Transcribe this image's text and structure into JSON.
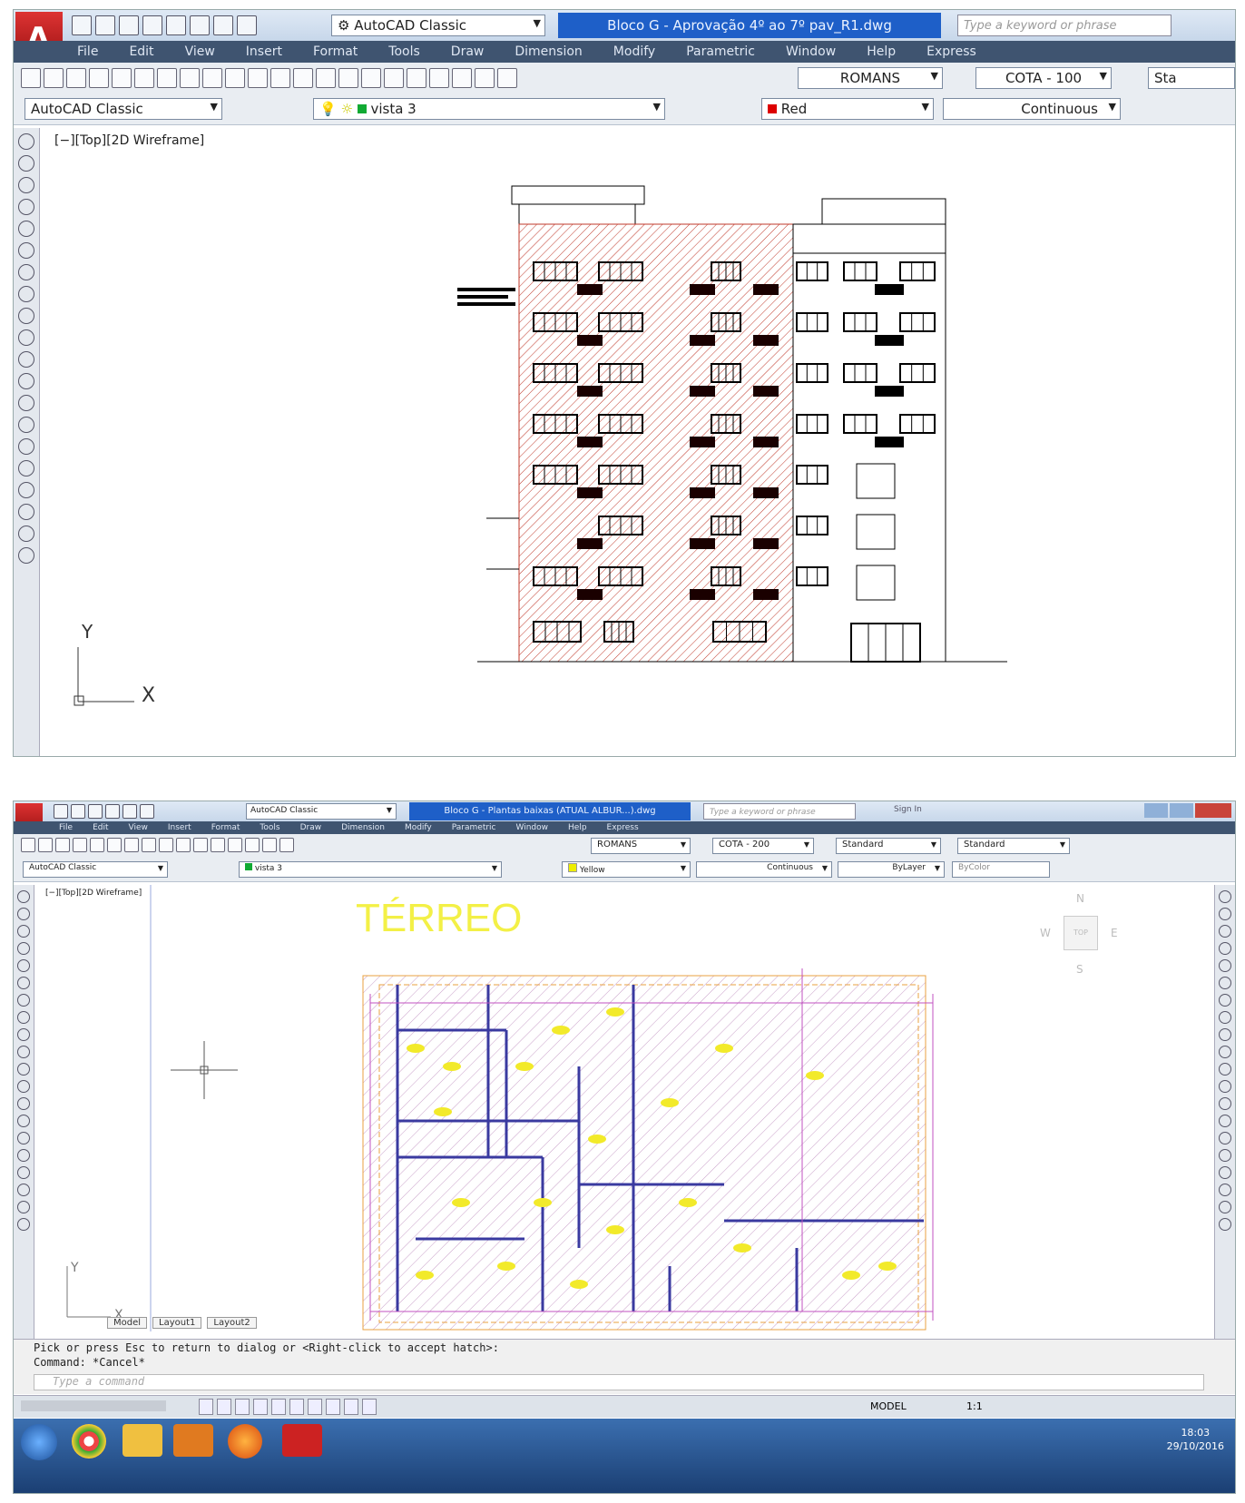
{
  "shot1": {
    "logo": "A",
    "workspace": "AutoCAD Classic",
    "doc_title": "Bloco G - Aprovação 4º ao 7º pav_R1.dwg",
    "search_placeholder": "Type a keyword or phrase",
    "menu": [
      "File",
      "Edit",
      "View",
      "Insert",
      "Format",
      "Tools",
      "Draw",
      "Dimension",
      "Modify",
      "Parametric",
      "Window",
      "Help",
      "Express"
    ],
    "text_style": "ROMANS",
    "dim_style": "COTA - 100",
    "table_style_partial": "Sta",
    "workspace_combo": "AutoCAD Classic",
    "layer": "vista 3",
    "color": "Red",
    "linetype": "Continuous",
    "viewport_label": "[−][Top][2D Wireframe]",
    "ucs_x": "X",
    "ucs_y": "Y"
  },
  "shot2": {
    "doc_title": "Bloco G - Plantas baixas (ATUAL ALBUR...).dwg",
    "search_placeholder": "Type a keyword or phrase",
    "sign_in": "Sign In",
    "workspace": "AutoCAD Classic",
    "menu": [
      "File",
      "Edit",
      "View",
      "Insert",
      "Format",
      "Tools",
      "Draw",
      "Dimension",
      "Modify",
      "Parametric",
      "Window",
      "Help",
      "Express"
    ],
    "text_style": "ROMANS",
    "dim_style": "COTA - 200",
    "table_style": "Standard",
    "mleader_style": "Standard",
    "workspace_combo": "AutoCAD Classic",
    "layer": "vista 3",
    "color": "Yellow",
    "linetype": "Continuous",
    "lineweight": "ByLayer",
    "plotstyle": "ByColor",
    "viewport_label": "[−][Top][2D Wireframe]",
    "drawing_title": "TÉRREO",
    "viewcube": {
      "n": "N",
      "s": "S",
      "e": "E",
      "w": "W",
      "top": "TOP"
    },
    "layout_tabs": [
      "Model",
      "Layout1",
      "Layout2"
    ],
    "cmd_history": [
      "Pick or press Esc to return to dialog or <Right-click to accept hatch>:",
      "Command: *Cancel*"
    ],
    "cmd_placeholder": "Type a command",
    "status_model": "MODEL",
    "scale": "1:1",
    "clock_time": "18:03",
    "clock_date": "29/10/2016",
    "ucs_x": "X",
    "ucs_y": "Y"
  },
  "colors": {
    "title_active": "#1e5fc8",
    "menu_bg": "#3f5470",
    "hatch_red": "#c0392b",
    "plan_yellow": "#f2ea2a",
    "plan_magenta": "#c050c0",
    "plan_blue": "#3a3aa0"
  }
}
